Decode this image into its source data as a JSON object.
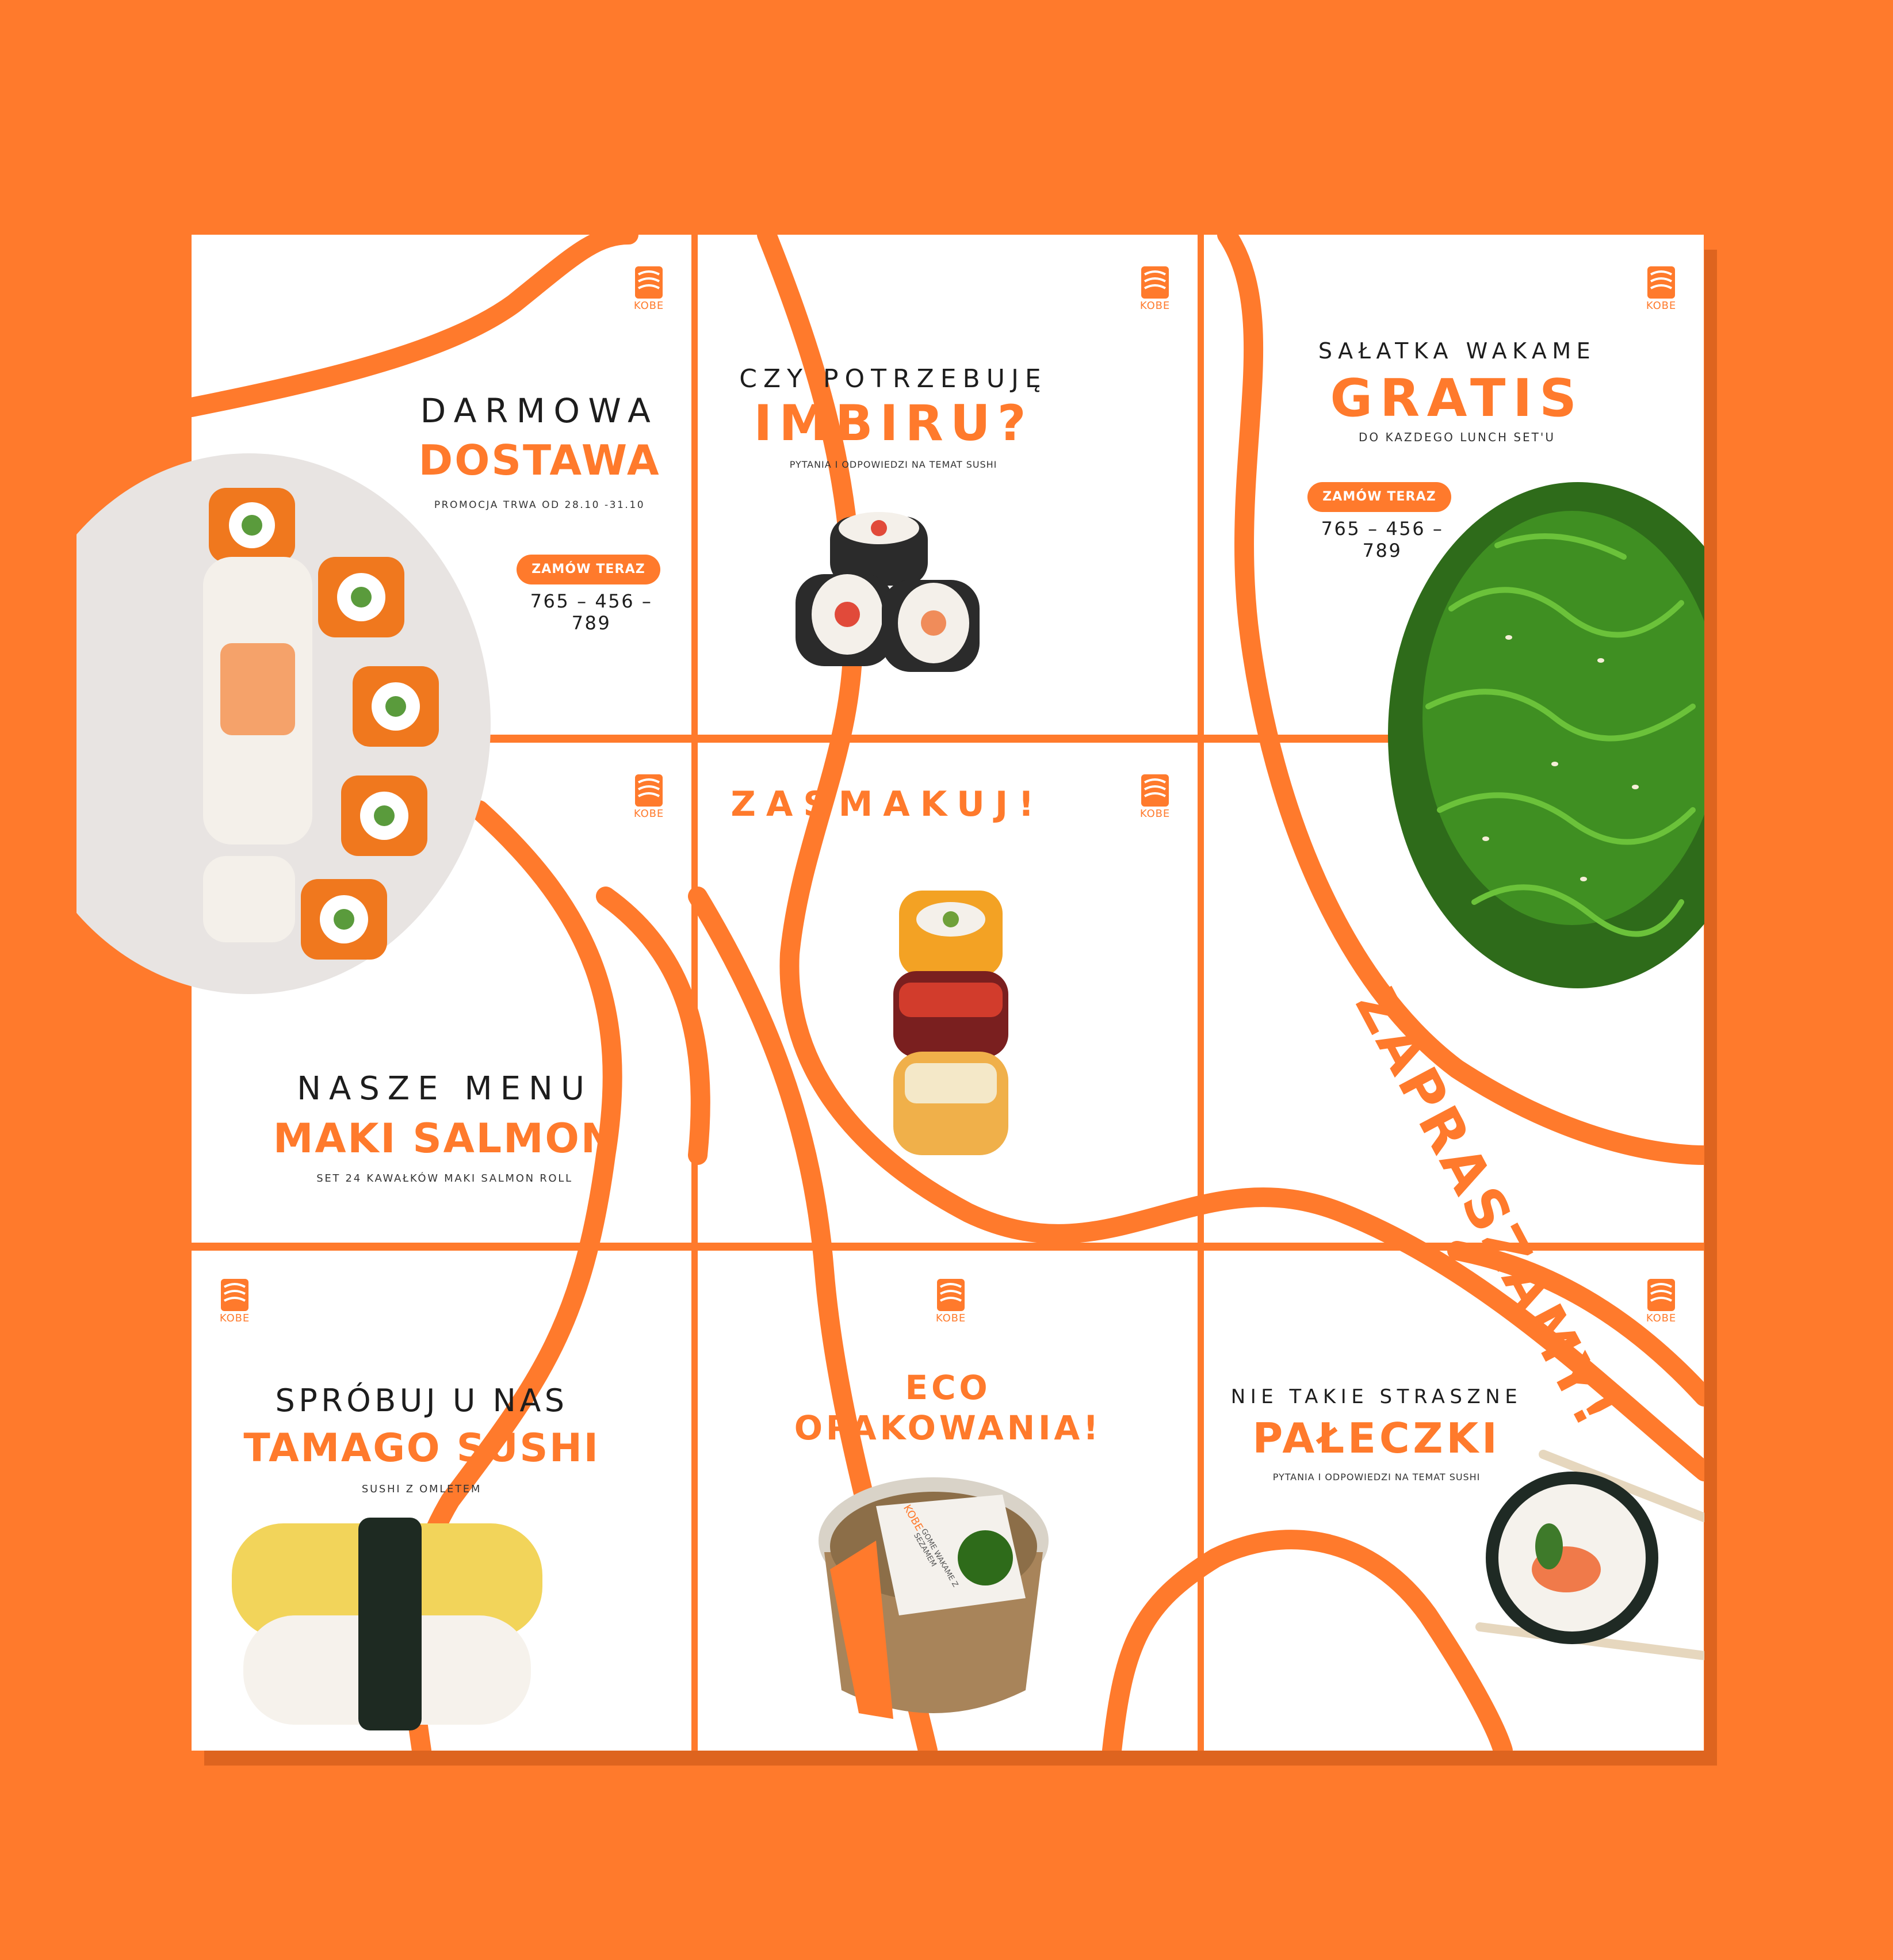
{
  "brand": "KOBE",
  "colors": {
    "accent": "#FF7A2C",
    "background": "#FF7A2C",
    "tile": "#FFFFFF",
    "text": "#1D1D1D"
  },
  "tiles": {
    "t1": {
      "line1": "DARMOWA",
      "line2": "DOSTAWA",
      "sub": "PROMOCJA TRWA OD 28.10 -31.10",
      "button": "ZAMÓW TERAZ",
      "phone": "765 – 456 – 789"
    },
    "t2": {
      "line1": "CZY POTRZEBUJĘ",
      "line2": "IMBIRU?",
      "sub": "PYTANIA I ODPOWIEDZI NA TEMAT SUSHI"
    },
    "t3": {
      "line1": "SAŁATKA WAKAME",
      "line2": "GRATIS",
      "sub": "DO KAZDEGO LUNCH SET'U",
      "button": "ZAMÓW TERAZ",
      "phone": "765 – 456 – 789"
    },
    "t4": {
      "line1": "NASZE MENU",
      "line2": "MAKI SALMON",
      "sub": "SET 24 KAWAŁKÓW MAKI SALMON ROLL"
    },
    "t5": {
      "line1": "ZASMAKUJ!"
    },
    "t6": {
      "line1": "ZAPRASZAMY!"
    },
    "t7": {
      "line1": "SPRÓBUJ U NAS",
      "line2": "TAMAGO SUSHI",
      "sub": "SUSHI Z OMLETEM"
    },
    "t8": {
      "line1": "ECO",
      "line2": "OPAKOWANIA!",
      "package_brand": "KOBE",
      "package_text": "GOME WAKAME Z SEZAMEM"
    },
    "t9": {
      "line1": "NIE TAKIE STRASZNE",
      "line2": "PAŁECZKI",
      "sub": "PYTANIA I ODPOWIEDZI NA TEMAT SUSHI"
    }
  }
}
